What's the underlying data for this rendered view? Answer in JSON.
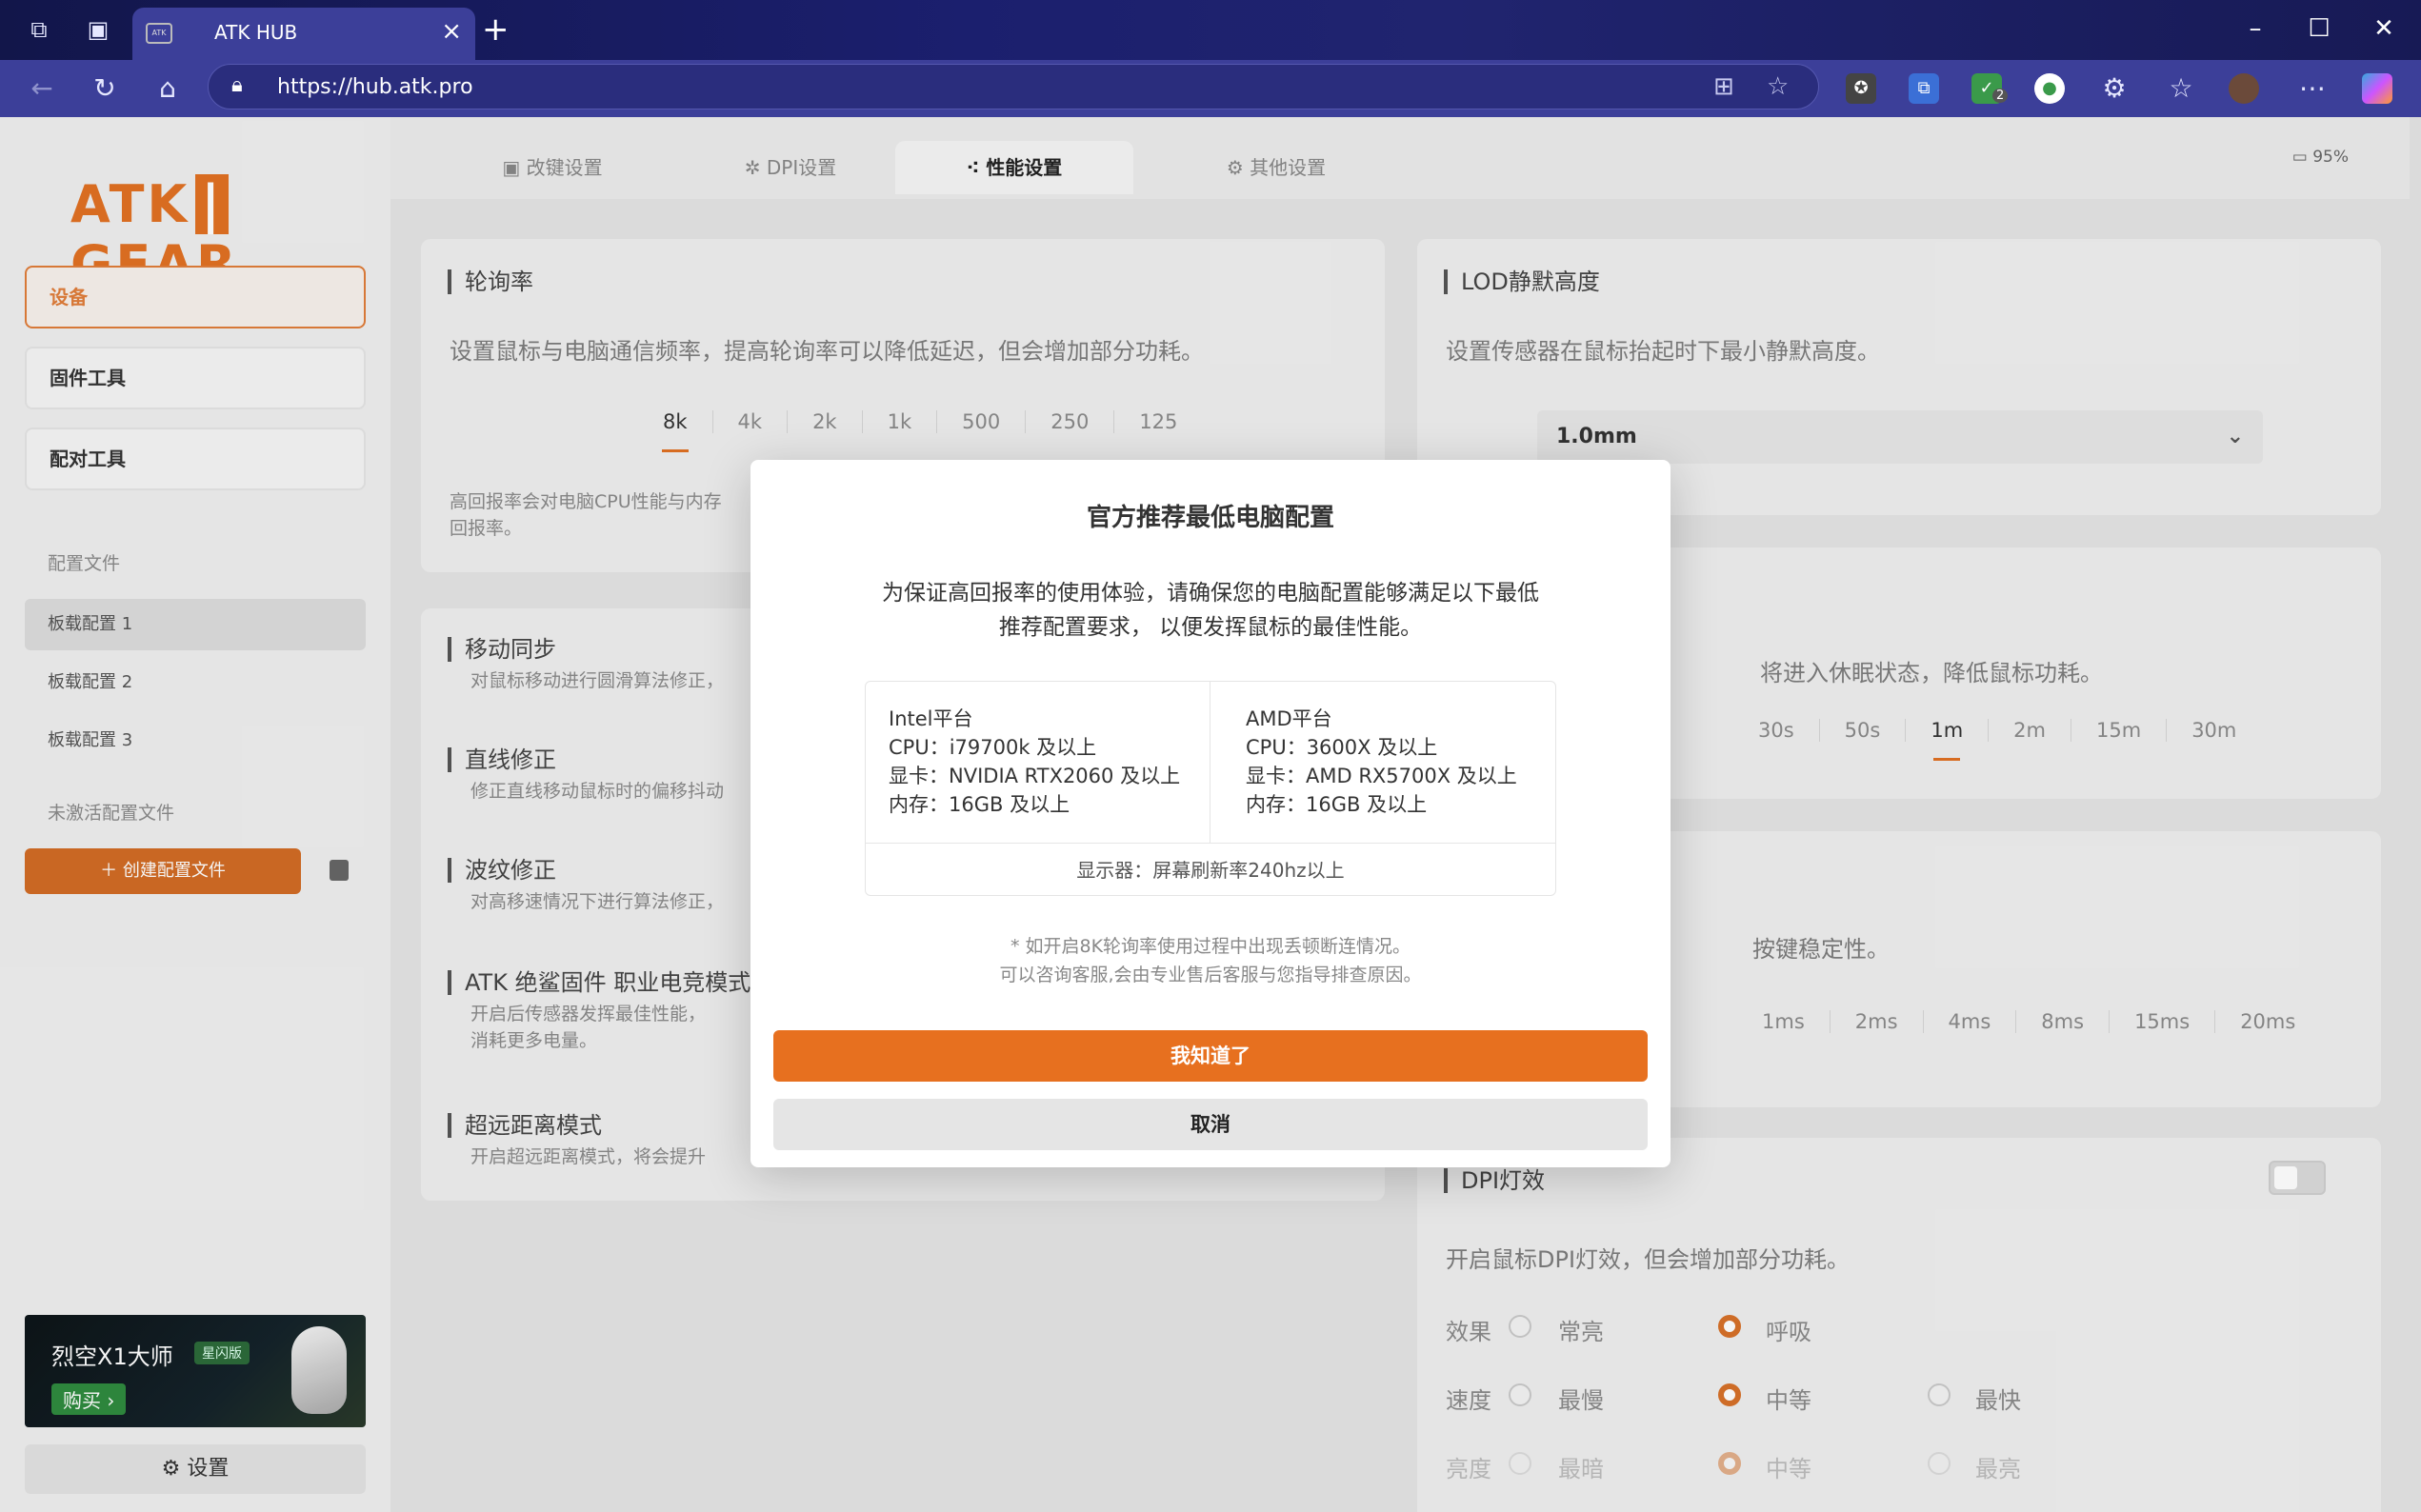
{
  "browser": {
    "tab_title": "ATK HUB",
    "tab_favicon": "ATK",
    "url": "https://hub.atk.pro",
    "ext_badge": "2"
  },
  "sidebar": {
    "logo_left": "ATK",
    "logo_right": "GEAR",
    "nav": [
      {
        "label": "设备"
      },
      {
        "label": "固件工具"
      },
      {
        "label": "配对工具"
      }
    ],
    "profiles_header": "配置文件",
    "profiles": [
      {
        "label": "板载配置 1"
      },
      {
        "label": "板载配置 2"
      },
      {
        "label": "板载配置 3"
      }
    ],
    "inactive_header": "未激活配置文件",
    "create_label": "创建配置文件",
    "banner": {
      "title": "烈空X1大师",
      "tag": "星闪版",
      "buy": "购买 ›"
    },
    "settings_label": "设置"
  },
  "main": {
    "tabs": [
      {
        "label": "改键设置"
      },
      {
        "label": "DPI设置"
      },
      {
        "label": "性能设置"
      },
      {
        "label": "其他设置"
      }
    ],
    "battery": "95%",
    "polling": {
      "title": "轮询率",
      "desc": "设置鼠标与电脑通信频率，提高轮询率可以降低延迟，但会增加部分功耗。",
      "options": [
        "8k",
        "4k",
        "2k",
        "1k",
        "500",
        "250",
        "125"
      ],
      "note_l1": "高回报率会对电脑CPU性能与内存",
      "note_l2": "回报率。"
    },
    "items": [
      {
        "title": "移动同步",
        "desc": "对鼠标移动进行圆滑算法修正，"
      },
      {
        "title": "直线修正",
        "desc": "修正直线移动鼠标时的偏移抖动"
      },
      {
        "title": "波纹修正",
        "desc": "对高移速情况下进行算法修正，"
      },
      {
        "title": "ATK 绝鲨固件 职业电竞模式",
        "desc": "开启后传感器发挥最佳性能，",
        "desc2": "消耗更多电量。"
      },
      {
        "title": "超远距离模式",
        "desc": "开启超远距离模式，将会提升"
      }
    ],
    "lod": {
      "title": "LOD静默高度",
      "desc": "设置传感器在鼠标抬起时下最小静默高度。",
      "value": "1.0mm"
    },
    "sleep": {
      "desc": "将进入休眠状态，降低鼠标功耗。",
      "options": [
        "30s",
        "50s",
        "1m",
        "2m",
        "15m",
        "30m"
      ]
    },
    "debounce": {
      "desc": "按键稳定性。",
      "options": [
        "1ms",
        "2ms",
        "4ms",
        "8ms",
        "15ms",
        "20ms"
      ]
    },
    "dpi_light": {
      "title": "DPI灯效",
      "desc": "开启鼠标DPI灯效，但会增加部分功耗。",
      "rows": [
        {
          "label": "效果",
          "opts": [
            "常亮",
            "呼吸"
          ]
        },
        {
          "label": "速度",
          "opts": [
            "最慢",
            "中等",
            "最快"
          ]
        },
        {
          "label": "亮度",
          "opts": [
            "最暗",
            "中等",
            "最亮"
          ]
        }
      ]
    }
  },
  "modal": {
    "title": "官方推荐最低电脑配置",
    "intro_l1": "为保证高回报率的使用体验，请确保您的电脑配置能够满足以下最低",
    "intro_l2": "推荐配置要求， 以便发挥鼠标的最佳性能。",
    "intel": {
      "platform": "Intel平台",
      "cpu": "CPU：i79700k 及以上",
      "gpu": "显卡：NVIDIA RTX2060 及以上",
      "ram": "内存：16GB 及以上"
    },
    "amd": {
      "platform": "AMD平台",
      "cpu": "CPU：3600X 及以上",
      "gpu": "显卡：AMD RX5700X 及以上",
      "ram": "内存：16GB 及以上"
    },
    "monitor": "显示器：屏幕刷新率240hz以上",
    "note_l1": "* 如开启8K轮询率使用过程中出现丢顿断连情况。",
    "note_l2": "可以咨询客服,会由专业售后客服与您指导排查原因。",
    "confirm": "我知道了",
    "cancel": "取消"
  },
  "colors": {
    "accent": "#e7701f",
    "browser_bar": "#3c3f99"
  }
}
